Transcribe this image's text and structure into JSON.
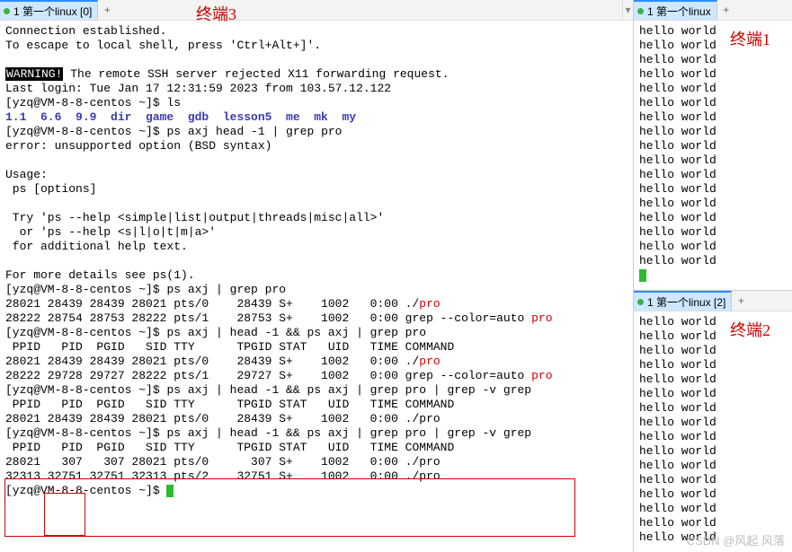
{
  "annotations": {
    "term3": "终端3",
    "term1": "终端1",
    "term2": "终端2"
  },
  "tabs": {
    "left": {
      "label": "1 第一个linux [0]",
      "add": "+",
      "arrow": "▾"
    },
    "right1": {
      "label": "1 第一个linux",
      "add": "+"
    },
    "right2": {
      "label": "1 第一个linux [2]",
      "add": "+"
    }
  },
  "left_term": {
    "l1": "Connection established.",
    "l2": "To escape to local shell, press 'Ctrl+Alt+]'.",
    "warn": "WARNING!",
    "l3": " The remote SSH server rejected X11 forwarding request.",
    "l4": "Last login: Tue Jan 17 12:31:59 2023 from 103.57.12.122",
    "p1": "[yzq@VM-8-8-centos ~]$ ",
    "c1": "ls",
    "dirs": "1.1  6.6  9.9  dir  game  gdb  lesson5  me  mk  my",
    "p2": "[yzq@VM-8-8-centos ~]$ ",
    "c2": "ps axj head -1 | grep pro",
    "err": "error: unsupported option (BSD syntax)",
    "us1": "Usage:",
    "us2": " ps [options]",
    "us3": " Try 'ps --help <simple|list|output|threads|misc|all>'",
    "us4": "  or 'ps --help <s|l|o|t|m|a>'",
    "us5": " for additional help text.",
    "us6": "For more details see ps(1).",
    "p3": "[yzq@VM-8-8-centos ~]$ ",
    "c3": "ps axj | grep pro",
    "r1a": "28021 28439 28439 28021 pts/0    28439 S+    1002   0:00 ./",
    "r1b": "pro",
    "r2a": "28222 28754 28753 28222 pts/1    28753 S+    1002   0:00 grep --color=auto ",
    "r2b": "pro",
    "p4": "[yzq@VM-8-8-centos ~]$ ",
    "c4": "ps axj | head -1 && ps axj | grep pro",
    "hd": " PPID   PID  PGID   SID TTY      TPGID STAT   UID   TIME COMMAND",
    "r3a": "28021 28439 28439 28021 pts/0    28439 S+    1002   0:00 ./",
    "r3b": "pro",
    "r4a": "28222 29728 29727 28222 pts/1    29727 S+    1002   0:00 grep --color=auto ",
    "r4b": "pro",
    "p5": "[yzq@VM-8-8-centos ~]$ ",
    "c5": "ps axj | head -1 && ps axj | grep pro | grep -v grep",
    "r5": "28021 28439 28439 28021 pts/0    28439 S+    1002   0:00 ./pro",
    "p6": "[yzq@VM-8-8-centos ~]$ ",
    "c6": "ps axj | head -1 && ps axj | grep pro | grep -v grep",
    "r6": "28021   307   307 28021 pts/0      307 S+    1002   0:00 ./pro",
    "r7": "32313 32751 32751 32313 pts/2    32751 S+    1002   0:00 ./pro",
    "p7": "[yzq@VM-8-8-centos ~]$ "
  },
  "right_term": {
    "hello": "hello world",
    "count_top": 17,
    "count_bot": 16
  },
  "watermark": "CSDN @风起 风落"
}
